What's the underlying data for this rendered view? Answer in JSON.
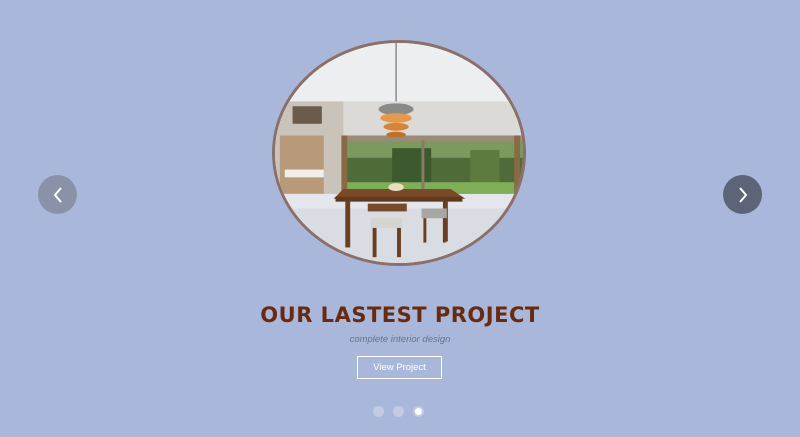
{
  "slide": {
    "title": "OUR LASTEST PROJECT",
    "subtitle": "complete interior design",
    "button_label": "View Project",
    "image_alt": "Dining room interior with wooden table and pendant lamp"
  },
  "navigation": {
    "prev_icon": "chevron-left-icon",
    "next_icon": "chevron-right-icon"
  },
  "pagination": {
    "total": 3,
    "active_index": 3
  },
  "colors": {
    "background": "#a9b8da",
    "title": "#6a2a12",
    "subtitle": "#6d7284",
    "ring": "#8a6f6a"
  }
}
